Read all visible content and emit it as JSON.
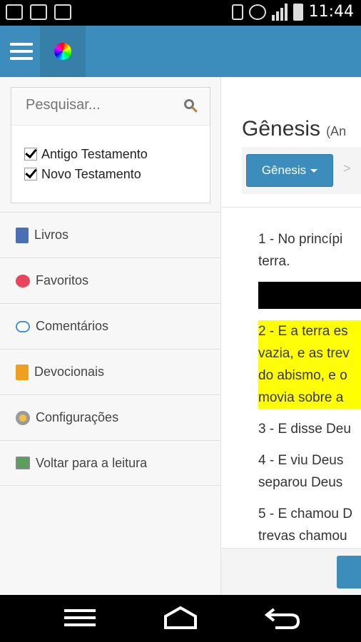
{
  "status_bar": {
    "time": "11:44",
    "icons": [
      "gallery-icon",
      "app-icon",
      "voicemail-icon",
      "vibrate-icon",
      "alarm-icon",
      "hplus-icon",
      "signal-icon",
      "battery-icon"
    ]
  },
  "toolbar": {
    "menu_icon": "hamburger-icon",
    "color_icon": "color-wheel-icon",
    "accent_color": "#3c8dbc"
  },
  "search": {
    "placeholder": "Pesquisar...",
    "value": "",
    "icon": "search-icon"
  },
  "filters": [
    {
      "label": "Antigo Testamento",
      "checked": true
    },
    {
      "label": "Novo Testamento",
      "checked": true
    }
  ],
  "menu": [
    {
      "label": "Livros",
      "icon": "book-icon"
    },
    {
      "label": "Favoritos",
      "icon": "heart-icon"
    },
    {
      "label": "Comentários",
      "icon": "comment-icon"
    },
    {
      "label": "Devocionais",
      "icon": "devotional-icon"
    },
    {
      "label": "Configurações",
      "icon": "gear-icon"
    },
    {
      "label": "Voltar para a leitura",
      "icon": "back-to-reading-icon"
    }
  ],
  "content": {
    "title": "Gênesis",
    "subtitle": "(An",
    "book_button": "Gênesis",
    "crumb_separator": ">"
  },
  "verses": {
    "v1a": "1 - No princípi",
    "v1b": "terra.",
    "v2a": "2 - E a terra es",
    "v2b": "vazia, e as trev",
    "v2c": "do abismo, e o",
    "v2d": "movia sobre a",
    "v3": "3 - E disse Deu",
    "v4a": "4 - E viu Deus",
    "v4b": "separou Deus",
    "v5a": "5 - E chamou D",
    "v5b": "trevas chamou",
    "highlight_color": "#ffff00"
  },
  "system_nav": {
    "icons": [
      "recent-apps-icon",
      "home-icon",
      "back-icon"
    ]
  }
}
